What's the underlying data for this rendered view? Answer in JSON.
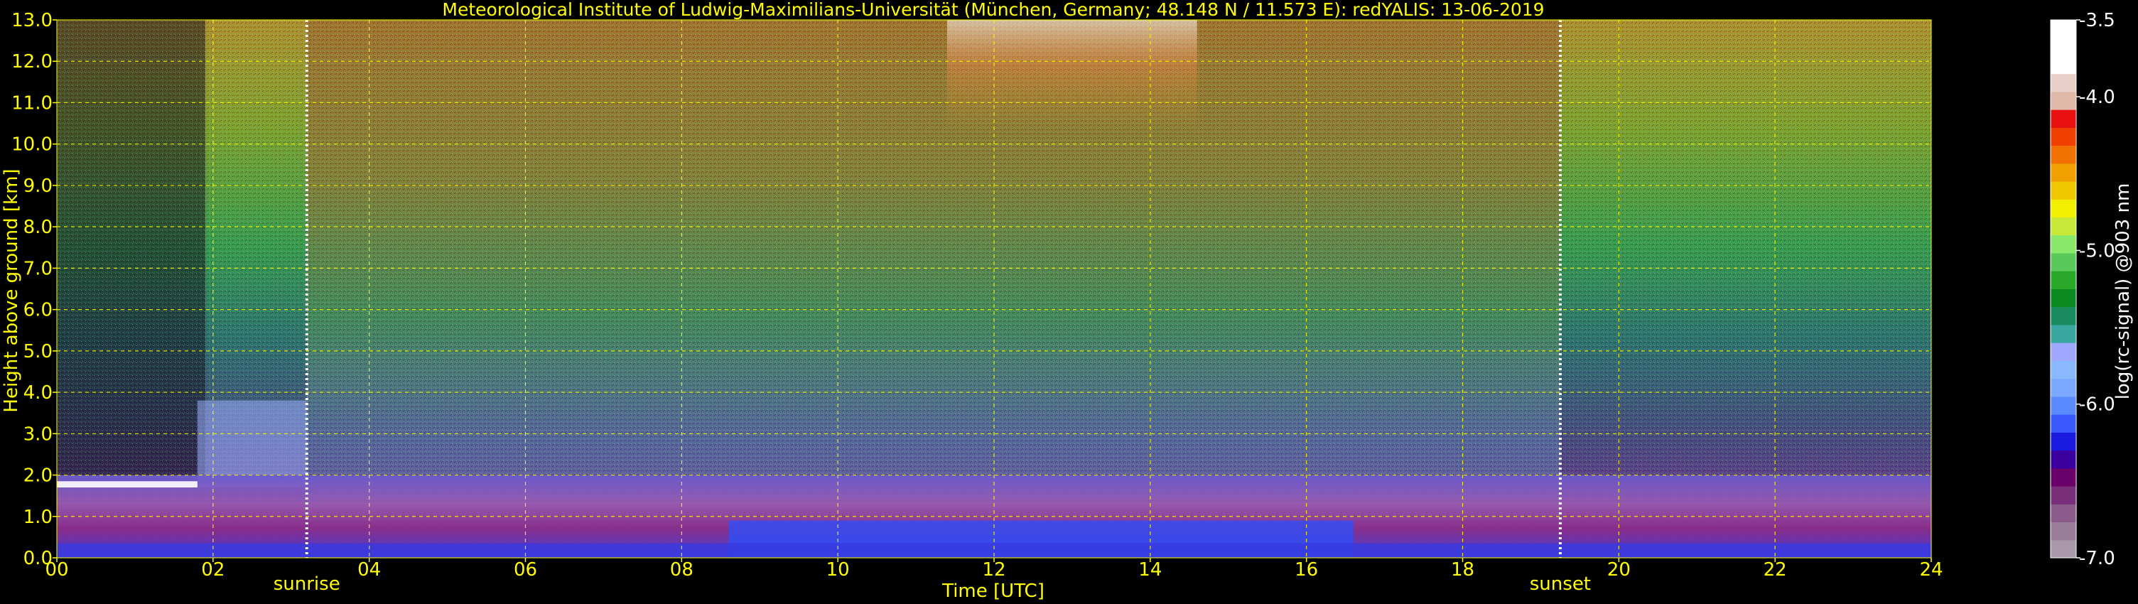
{
  "chart_data": {
    "type": "heatmap",
    "title": "Meteorological Institute of Ludwig-Maximilians-Universität (München, Germany; 48.148 N / 11.573 E):    redYALIS: 13-06-2019",
    "xlabel": "Time [UTC]",
    "ylabel": "Height above ground [km]",
    "xlim": [
      0,
      24
    ],
    "ylim": [
      0,
      13
    ],
    "x_ticks": [
      "00",
      "02",
      "04",
      "06",
      "08",
      "10",
      "12",
      "14",
      "16",
      "18",
      "20",
      "22",
      "24"
    ],
    "x_tick_values": [
      0,
      2,
      4,
      6,
      8,
      10,
      12,
      14,
      16,
      18,
      20,
      22,
      24
    ],
    "y_ticks": [
      "0.0",
      "1.0",
      "2.0",
      "3.0",
      "4.0",
      "5.0",
      "6.0",
      "7.0",
      "8.0",
      "9.0",
      "10.0",
      "11.0",
      "12.0",
      "13.0"
    ],
    "y_tick_values": [
      0,
      1,
      2,
      3,
      4,
      5,
      6,
      7,
      8,
      9,
      10,
      11,
      12,
      13
    ],
    "grid": true,
    "annotations": [
      {
        "label": "sunrise",
        "x": 3.2
      },
      {
        "label": "sunset",
        "x": 19.25
      }
    ],
    "colorbar": {
      "label": "log(rc-signal) @903 nm",
      "range": [
        -7.0,
        -3.5
      ],
      "tick_labels": [
        "-3.5",
        "-4.0",
        "-5.0",
        "-6.0",
        "-7.0"
      ],
      "tick_values": [
        -3.5,
        -4.0,
        -5.0,
        -6.0,
        -7.0
      ],
      "colors": [
        "#a898a8",
        "#9a7d9a",
        "#8a5a8a",
        "#7a2f7a",
        "#6a006a",
        "#3a00a0",
        "#1a1ae0",
        "#3a5aff",
        "#5a8aff",
        "#7aa8ff",
        "#8ab8ff",
        "#a0a8ff",
        "#3aa8a0",
        "#1a8a60",
        "#0a8a20",
        "#2aa82a",
        "#5ac85a",
        "#8ae86a",
        "#c8e83a",
        "#f0f000",
        "#f0c800",
        "#f0a000",
        "#f07000",
        "#f04000",
        "#e81010",
        "#e0b8a8",
        "#e8d0c8",
        "#ffffff",
        "#ffffff",
        "#ffffff"
      ]
    },
    "main_color": "#ffff00"
  }
}
